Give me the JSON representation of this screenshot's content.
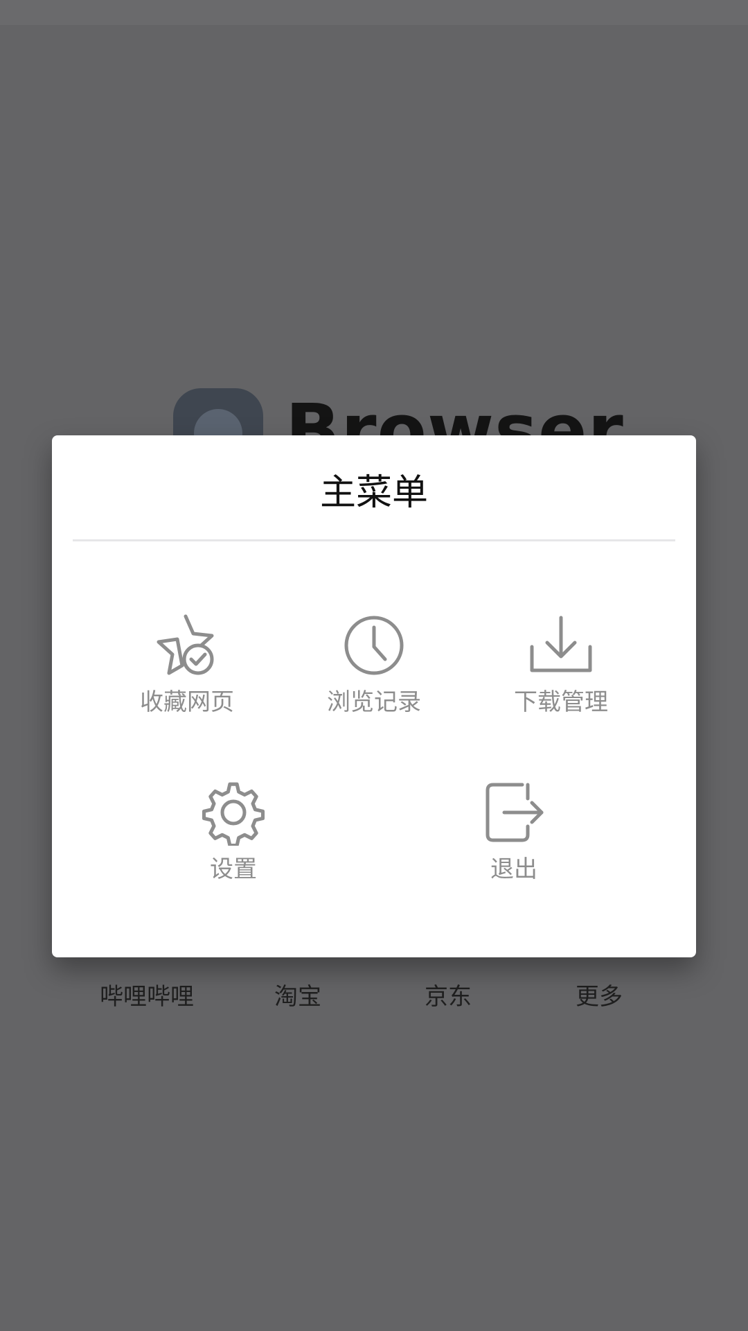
{
  "background": {
    "brand_text": "Browser",
    "shortcuts": [
      "哔哩哔哩",
      "淘宝",
      "京东",
      "更多"
    ]
  },
  "dialog": {
    "title": "主菜单",
    "items": [
      {
        "label": "收藏网页",
        "icon": "star-check-icon"
      },
      {
        "label": "浏览记录",
        "icon": "clock-icon"
      },
      {
        "label": "下载管理",
        "icon": "download-icon"
      },
      {
        "label": "设置",
        "icon": "gear-icon"
      },
      {
        "label": "退出",
        "icon": "exit-icon"
      }
    ]
  },
  "colors": {
    "overlay": "#646466",
    "dialog_bg": "#ffffff",
    "icon_gray": "#8d8d8d",
    "title": "#111111"
  }
}
